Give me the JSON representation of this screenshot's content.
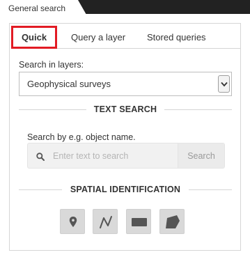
{
  "window": {
    "tab_label": "General search"
  },
  "tabs": [
    {
      "label": "Quick",
      "active": true
    },
    {
      "label": "Query a layer",
      "active": false
    },
    {
      "label": "Stored queries",
      "active": false
    }
  ],
  "layers": {
    "label": "Search in layers:",
    "selected": "Geophysical surveys"
  },
  "text_search": {
    "heading": "TEXT SEARCH",
    "hint": "Search by e.g. object name.",
    "placeholder": "Enter text to search",
    "button_label": "Search"
  },
  "spatial": {
    "heading": "SPATIAL IDENTIFICATION",
    "tools": [
      {
        "name": "point-tool",
        "icon": "map-pin-icon"
      },
      {
        "name": "line-tool",
        "icon": "polyline-icon"
      },
      {
        "name": "rectangle-tool",
        "icon": "rectangle-icon"
      },
      {
        "name": "polygon-tool",
        "icon": "polygon-icon"
      }
    ]
  },
  "colors": {
    "active_tab_border": "#e21b24",
    "header_bar": "#222222",
    "tool_button": "#d9d9d9",
    "tool_icon": "#555555"
  }
}
